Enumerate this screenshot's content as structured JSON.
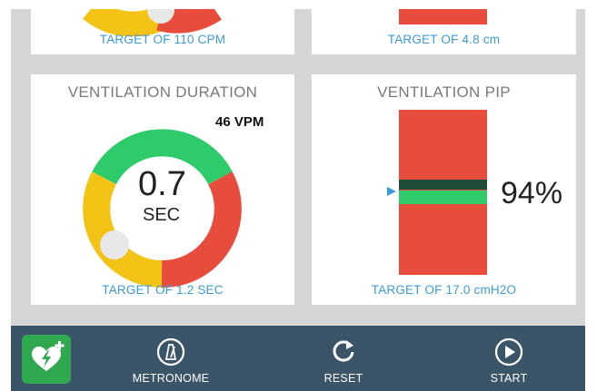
{
  "cards": {
    "top_left": {
      "target": "TARGET OF 110 CPM"
    },
    "top_right": {
      "target": "TARGET OF 4.8 cm"
    },
    "duration": {
      "title": "VENTILATION DURATION",
      "rate": "46 VPM",
      "value": "0.7",
      "unit": "SEC",
      "target": "TARGET OF 1.2 SEC"
    },
    "pip": {
      "title": "VENTILATION PIP",
      "percent": "94%",
      "target": "TARGET OF 17.0 cmH2O"
    }
  },
  "toolbar": {
    "metronome_label": "METRONOME",
    "reset_label": "RESET",
    "start_label": "START"
  },
  "icons": {
    "aed": "heart-defibrillator-icon",
    "metronome": "metronome-icon",
    "reset": "reset-icon",
    "start": "play-icon"
  },
  "colors": {
    "green": "#2ecb6a",
    "red": "#e84c3d",
    "yellow": "#f3c315",
    "accent_blue": "#3a9bd6",
    "toolbar": "#3b5468"
  }
}
